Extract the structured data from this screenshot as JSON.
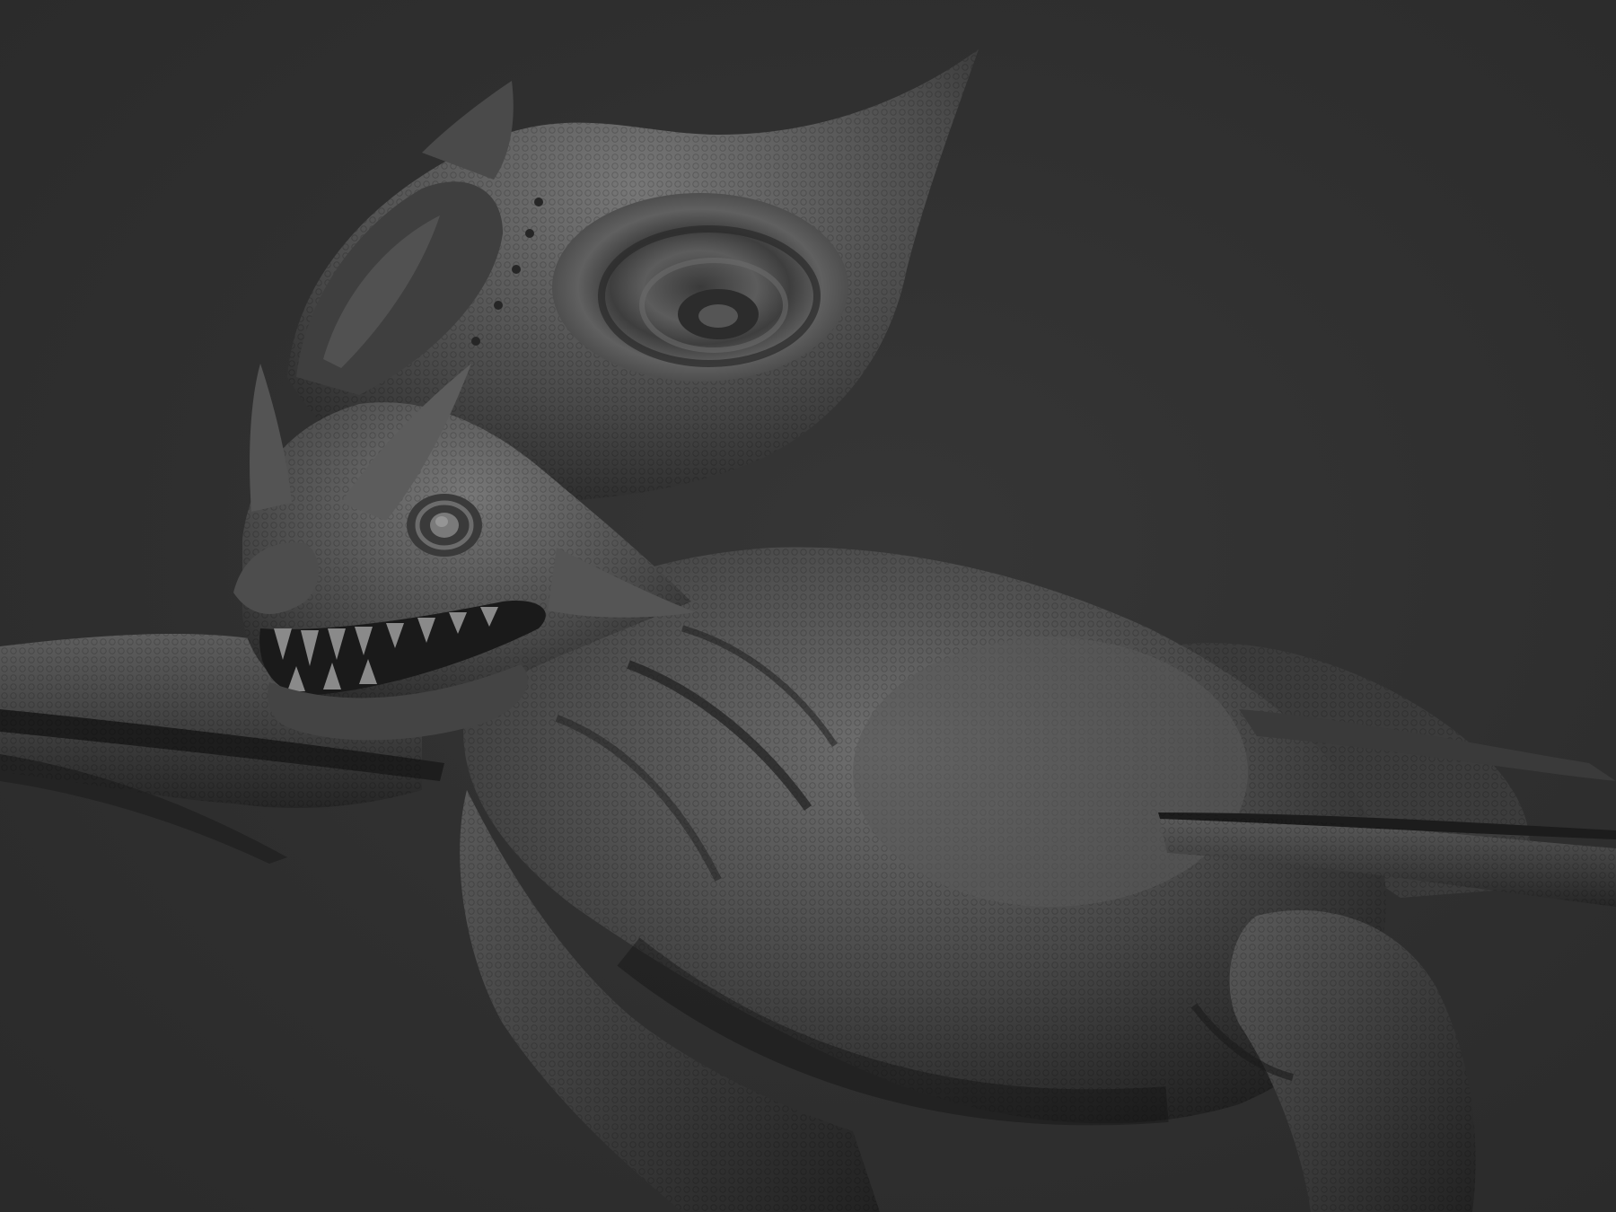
{
  "scene": {
    "subject": "creature-sculpt",
    "colors": {
      "background": "#2e2e2e",
      "clay_light": "#7a7a7a",
      "clay_mid": "#4a4a4a",
      "clay_dark": "#1c1c1c"
    }
  }
}
